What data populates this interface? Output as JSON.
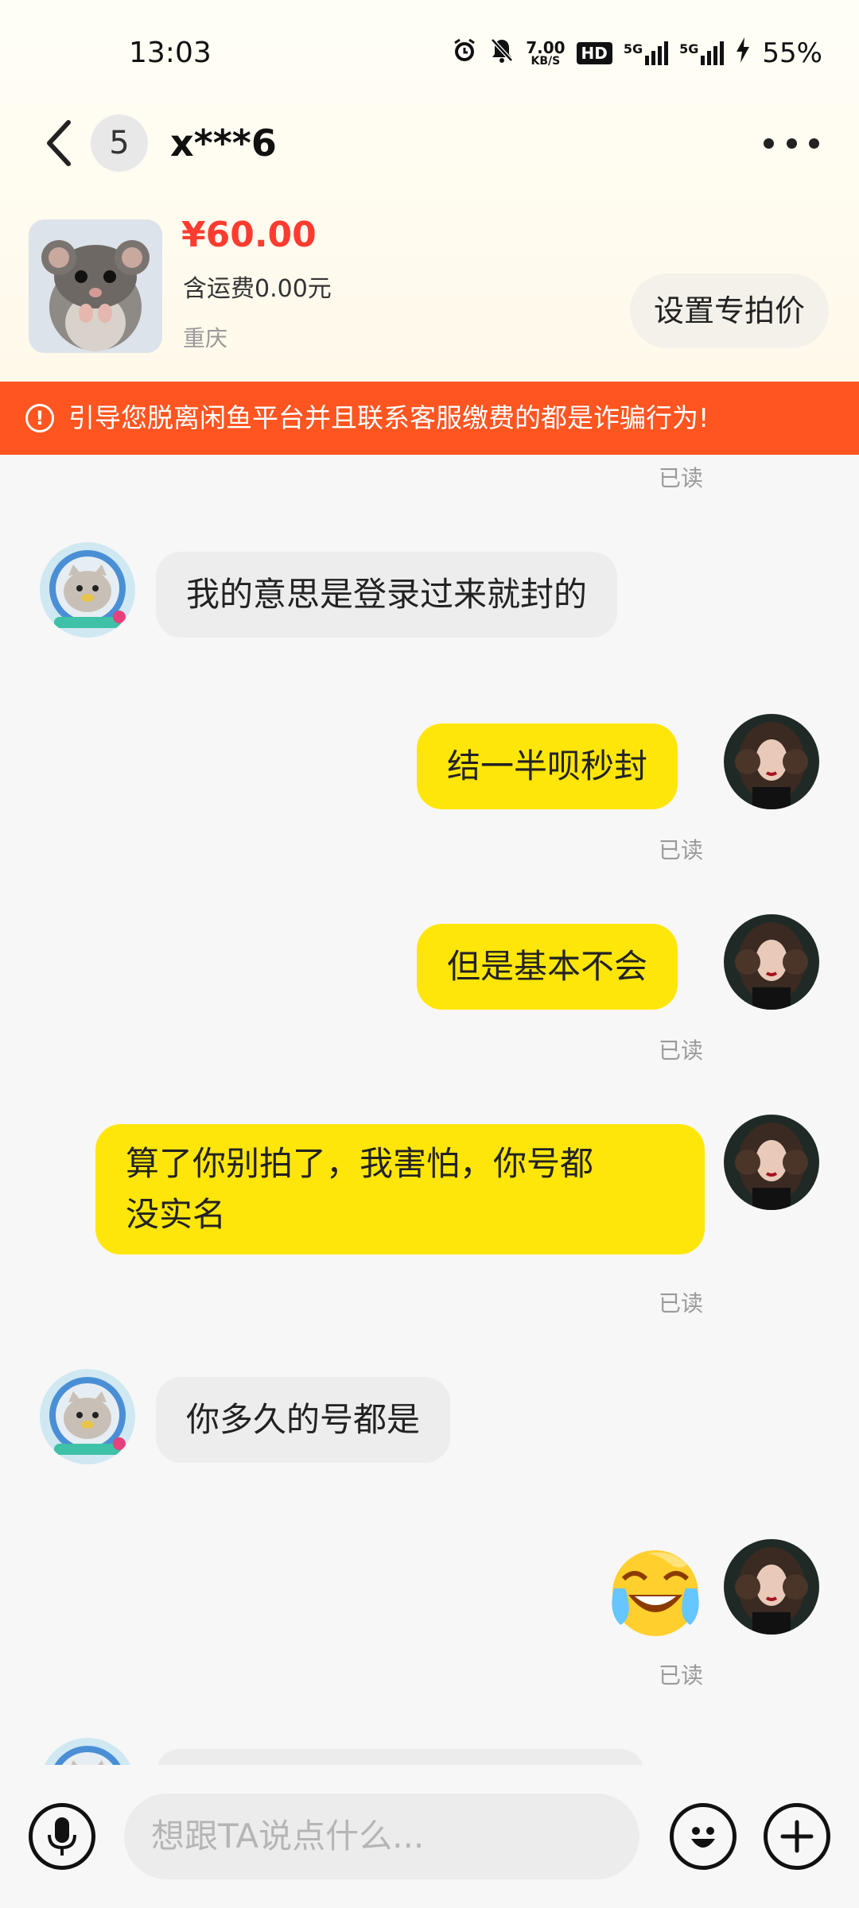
{
  "status_bar": {
    "time": "13:03",
    "net_speed_value": "7.00",
    "net_speed_unit": "KB/S",
    "hd": "HD",
    "sig1": "5G",
    "sig2": "5G",
    "battery": "55%"
  },
  "header": {
    "unread_count": "5",
    "title": "x***6"
  },
  "product": {
    "price": "¥60.00",
    "shipping": "含运费0.00元",
    "location": "重庆",
    "set_price_button": "设置专拍价"
  },
  "warning": {
    "text": "引导您脱离闲鱼平台并且联系客服缴费的都是诈骗行为!"
  },
  "messages": [
    {
      "side": "receipt",
      "read_label": "已读"
    },
    {
      "side": "left",
      "text": "我的意思是登录过来就封的"
    },
    {
      "side": "right",
      "text": "结一半呗秒封",
      "read_label": "已读"
    },
    {
      "side": "right",
      "text": "但是基本不会",
      "read_label": "已读"
    },
    {
      "side": "right",
      "text_line1": "算了你别拍了，我害怕，你号都",
      "text_line2": "没实名",
      "read_label": "已读"
    },
    {
      "side": "left",
      "text": "你多久的号都是"
    },
    {
      "side": "right",
      "emoji": "laughing-crying",
      "read_label": "已读"
    }
  ],
  "composer": {
    "placeholder": "想跟TA说点什么..."
  },
  "icons": {
    "back": "back-arrow-icon",
    "more": "more-dots-icon",
    "voice": "microphone-icon",
    "emoji": "emoji-icon",
    "plus": "plus-icon"
  },
  "colors": {
    "accent_yellow": "#ffe60a",
    "warning_orange": "#ff5521",
    "price_red": "#ff3b2f"
  }
}
